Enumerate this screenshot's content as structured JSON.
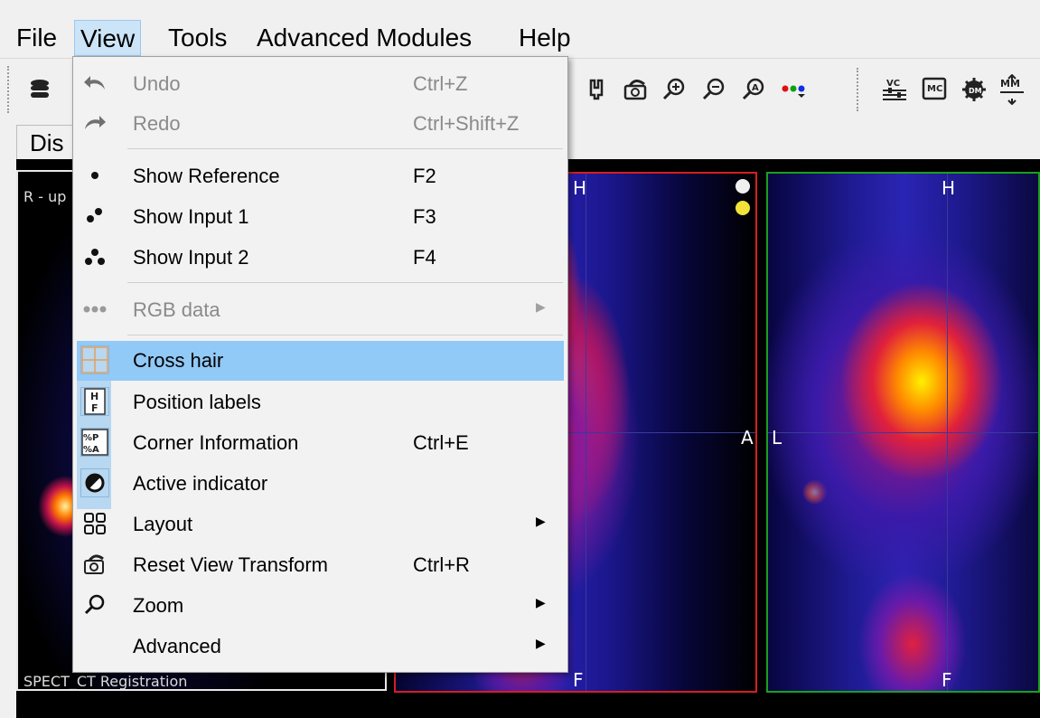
{
  "menubar": {
    "items": [
      "File",
      "View",
      "Tools",
      "Advanced Modules",
      "Help"
    ],
    "active": "View"
  },
  "toolbar": {
    "icons": [
      "database-icon",
      "hand-pan-icon",
      "reset-view-icon",
      "zoom-in-icon",
      "zoom-out-icon",
      "auto-zoom-icon",
      "rgb-data-icon",
      "vc-icon",
      "mc-icon",
      "dm-icon",
      "mm-icon"
    ]
  },
  "tab": {
    "label": "Dis"
  },
  "viewer": {
    "panel1": {
      "corner_top": "R - up",
      "corner_bottom": "SPECT_CT Registration"
    },
    "panel2": {
      "top_label": "H",
      "bottom_label": "F",
      "right_label": "A"
    },
    "panel3": {
      "top_label": "H",
      "bottom_label": "F",
      "left_label": "L"
    }
  },
  "view_menu": {
    "undo": {
      "label": "Undo",
      "shortcut": "Ctrl+Z"
    },
    "redo": {
      "label": "Redo",
      "shortcut": "Ctrl+Shift+Z"
    },
    "show_reference": {
      "label": "Show Reference",
      "shortcut": "F2"
    },
    "show_input1": {
      "label": "Show Input 1",
      "shortcut": "F3"
    },
    "show_input2": {
      "label": "Show Input 2",
      "shortcut": "F4"
    },
    "rgb_data": {
      "label": "RGB data"
    },
    "cross_hair": {
      "label": "Cross hair"
    },
    "position_labels": {
      "label": "Position labels",
      "icon_text": "H F"
    },
    "corner_information": {
      "label": "Corner Information",
      "shortcut": "Ctrl+E",
      "icon_text": "%P %A"
    },
    "active_indicator": {
      "label": "Active indicator"
    },
    "layout": {
      "label": "Layout"
    },
    "reset_view_transform": {
      "label": "Reset View Transform",
      "shortcut": "Ctrl+R"
    },
    "zoom": {
      "label": "Zoom"
    },
    "advanced": {
      "label": "Advanced"
    }
  },
  "colors": {
    "highlight": "#91c9f7",
    "checked_icon_bg": "#b8d7f0",
    "red_border": "#d51f1f",
    "green_border": "#1aa11a"
  }
}
